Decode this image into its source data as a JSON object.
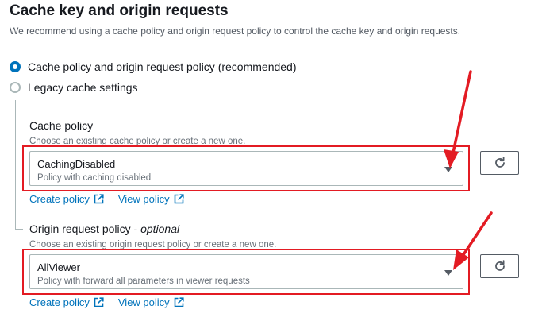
{
  "section": {
    "title": "Cache key and origin requests",
    "description": "We recommend using a cache policy and origin request policy to control the cache key and origin requests."
  },
  "radios": [
    {
      "label": "Cache policy and origin request policy (recommended)",
      "selected": true
    },
    {
      "label": "Legacy cache settings",
      "selected": false
    }
  ],
  "cache_policy": {
    "label": "Cache policy",
    "description": "Choose an existing cache policy or create a new one.",
    "selected_value": "CachingDisabled",
    "selected_description": "Policy with caching disabled",
    "links": {
      "create": "Create policy",
      "view": "View policy"
    }
  },
  "origin_request_policy": {
    "label": "Origin request policy",
    "label_suffix": "optional",
    "description": "Choose an existing origin request policy or create a new one.",
    "selected_value": "AllViewer",
    "selected_description": "Policy with forward all parameters in viewer requests",
    "links": {
      "create": "Create policy",
      "view": "View policy"
    }
  },
  "icons": {
    "refresh": "refresh-icon",
    "external_link": "external-link-icon",
    "dropdown": "caret-down-icon",
    "annotation_arrow": "annotation-arrow"
  },
  "colors": {
    "link": "#0073bb",
    "radio_selected": "#0073bb",
    "annotation": "#e31b23",
    "text": "#16191f",
    "secondary_text": "#545b64"
  }
}
